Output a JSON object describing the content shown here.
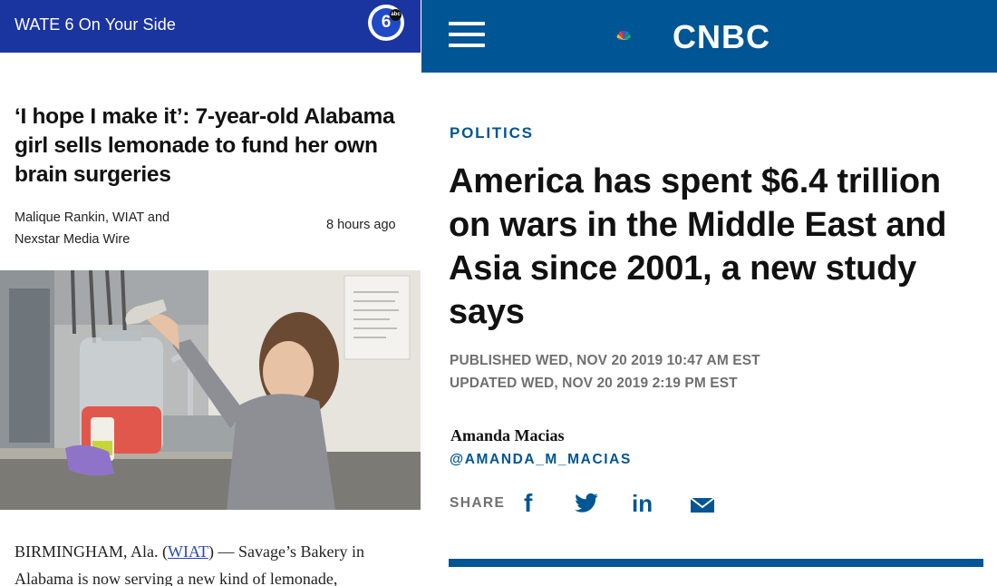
{
  "left_article": {
    "header_title": "WATE 6 On Your Side",
    "logo_number": "6",
    "logo_badge": "abc",
    "headline": "‘I hope I make it’: 7-year-old Alabama girl sells lemonade to fund her own brain surgeries",
    "byline_line1": "Malique Rankin, WIAT and",
    "byline_line2": "Nexstar Media Wire",
    "time_ago": "8 hours ago",
    "body_prefix": "BIRMINGHAM, Ala. (",
    "body_link": "WIAT",
    "body_suffix": ") — Savage’s Bakery in Alabama is now serving a new kind of lemonade,"
  },
  "right_article": {
    "brand": "CNBC",
    "category": "POLITICS",
    "headline": "America has spent $6.4 trillion on wars in the Middle East and Asia since 2001, a new study says",
    "published": "PUBLISHED WED, NOV 20 2019 10:47 AM EST",
    "updated": "UPDATED WED, NOV 20 2019 2:19 PM EST",
    "author": "Amanda Macias",
    "handle": "@AMANDA_M_MACIAS",
    "share_label": "SHARE",
    "share_icons": [
      "facebook-icon",
      "twitter-icon",
      "linkedin-icon",
      "email-icon"
    ]
  },
  "colors": {
    "wate_blue": "#1a34a0",
    "cnbc_blue": "#005594",
    "meta_gray": "#707070"
  }
}
